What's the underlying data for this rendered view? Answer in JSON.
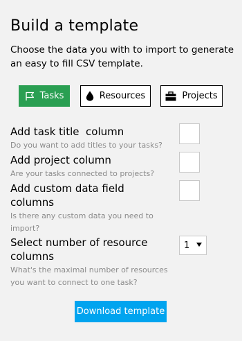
{
  "header": {
    "title": "Build a template",
    "intro": "Choose the data you with to import to generate an easy to fill CSV template."
  },
  "tabs": [
    {
      "label": "Tasks",
      "icon": "flag-icon",
      "active": true
    },
    {
      "label": "Resources",
      "icon": "drop-icon",
      "active": false
    },
    {
      "label": "Projects",
      "icon": "briefcase-icon",
      "active": false
    }
  ],
  "options": [
    {
      "label": "Add task title  column",
      "hint": "Do you want to add titles to your tasks?",
      "checked": false
    },
    {
      "label": "Add project column",
      "hint": "Are your tasks connected to projects?",
      "checked": false
    },
    {
      "label": "Add custom data field columns",
      "hint": "Is there any custom data you need to import?",
      "checked": false
    }
  ],
  "resources": {
    "label": "Select number of resource columns",
    "hint": "What's the maximal number of resources you want to connect to one task?",
    "selected": "1"
  },
  "download_label": "Download template",
  "colors": {
    "background": "#f2f2f2",
    "active_tab": "#2a9f52",
    "download_button": "#00a4ef",
    "hint_text": "#8a8a8a"
  }
}
